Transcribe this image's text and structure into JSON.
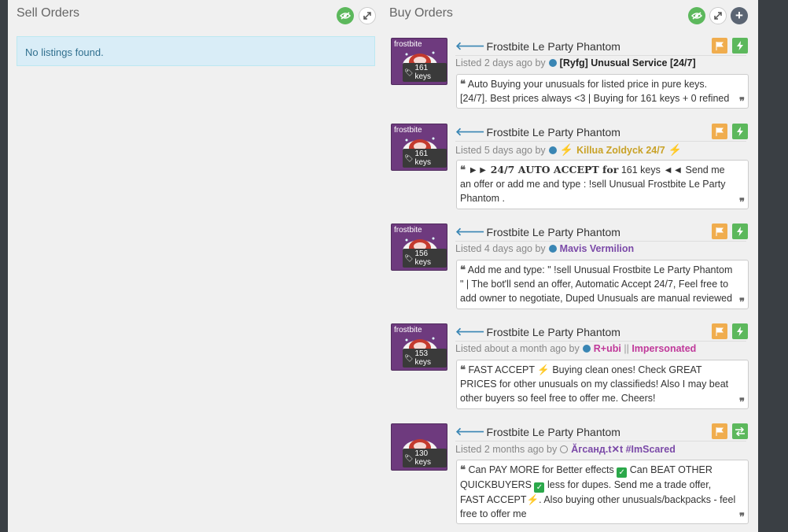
{
  "sell": {
    "title": "Sell Orders",
    "empty_message": "No listings found."
  },
  "buy": {
    "title": "Buy Orders",
    "listings": [
      {
        "effect": "frostbite",
        "price": "161 keys",
        "item_name": "Frostbite Le Party Phantom",
        "listed": "Listed 2 days ago by",
        "user": "[Ryfg] Unusual Service [24/7]",
        "user_color": "#222222",
        "comment": "Auto Buying your unusuals for listed price in pure keys. [24/7]. Best prices always <3 | Buying for 161 keys + 0 refined"
      },
      {
        "effect": "frostbite",
        "price": "161 keys",
        "item_name": "Frostbite Le Party Phantom",
        "listed": "Listed 5 days ago by",
        "user": "Killua Zoldyck 24/7",
        "user_color": "#c9a227",
        "comment_a": "►►",
        "comment_b": "24/7 AUTO ACCEPT for",
        "comment_c": " 161 keys ◄◄ Send me an offer or add me and type : !sell Unusual Frostbite Le Party Phantom ."
      },
      {
        "effect": "frostbite",
        "price": "156 keys",
        "item_name": "Frostbite Le Party Phantom",
        "listed": "Listed 4 days ago by",
        "user": "Mavis Vermilion",
        "user_color": "#7b4aa8",
        "comment": "Add me and type: \" !sell Unusual Frostbite Le Party Phantom \" | The bot'll send an offer, Automatic Accept 24/7, Feel free to add owner to negotiate, Duped Unusuals are manual reviewed"
      },
      {
        "effect": "frostbite",
        "price": "153 keys",
        "item_name": "Frostbite Le Party Phantom",
        "listed": "Listed about a month ago by",
        "user_a": "R+ubi",
        "user_sep": "||",
        "user_b": "Impersonated",
        "user_color": "#c0399a",
        "comment_a": "FAST ACCEPT",
        "comment_b": "Buying clean ones! Check GREAT PRICES for other unusuals on my classifieds! Also I may beat other buyers so feel free to offer me. Cheers!"
      },
      {
        "price": "130 keys",
        "item_name": "Frostbite Le Party Phantom",
        "listed": "Listed 2 months ago by",
        "user": "Ăгсанд.t✕t #ImScared",
        "user_color": "#7b4aa8",
        "comment_a": "Can PAY MORE for Better effects",
        "comment_b": "Can BEAT OTHER QUICKBUYERS",
        "comment_c": "less for dupes. Send me a trade offer, FAST ACCEPT",
        "comment_d": ". Also buying other unusuals/backpacks - feel free to offer me"
      }
    ]
  },
  "icons": {
    "show": "eye-icon",
    "expand": "expand-icon",
    "add": "plus-icon",
    "flag": "flag-icon",
    "bolt": "bolt-icon",
    "trade": "exchange-icon",
    "check": "check-icon"
  }
}
